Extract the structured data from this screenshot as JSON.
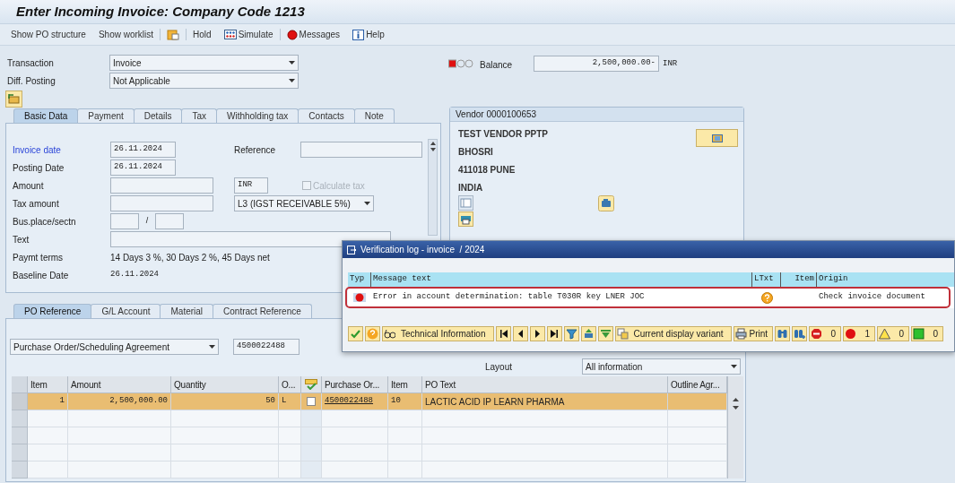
{
  "window": {
    "title": "Enter Incoming Invoice: Company Code 1213"
  },
  "toolbar": [
    [
      {
        "kind": "text",
        "label": "Show PO structure"
      },
      {
        "kind": "text",
        "label": "Show worklist"
      }
    ],
    [
      {
        "kind": "clipboard"
      }
    ],
    [
      {
        "kind": "text",
        "label": "Hold"
      },
      {
        "kind": "simulate",
        "label": "Simulate"
      }
    ],
    [
      {
        "kind": "messages",
        "label": "Messages"
      },
      {
        "kind": "help",
        "label": "Help"
      }
    ]
  ],
  "header": {
    "transaction": {
      "label": "Transaction",
      "value": "Invoice"
    },
    "diff_posting": {
      "label": "Diff. Posting",
      "value": "Not Applicable"
    },
    "balance": {
      "kind": "error",
      "label": "Balance",
      "value": "2,500,000.00-",
      "currency": "INR"
    }
  },
  "basic_tabs": [
    {
      "label": "Basic Data",
      "selected": true
    },
    {
      "label": "Payment",
      "selected": false
    },
    {
      "label": "Details",
      "selected": false
    },
    {
      "label": "Tax",
      "selected": false
    },
    {
      "label": "Withholding tax",
      "selected": false
    },
    {
      "label": "Contacts",
      "selected": false
    },
    {
      "label": "Note",
      "selected": false
    }
  ],
  "basic_data": {
    "invoice_date": {
      "label": "Invoice date",
      "value": "26.11.2024",
      "highlighted": true
    },
    "reference": {
      "label": "Reference"
    },
    "posting_date": {
      "label": "Posting Date",
      "value": "26.11.2024"
    },
    "amount": {
      "label": "Amount",
      "currency": "INR"
    },
    "calculate_tax": {
      "label": "Calculate tax",
      "checked": false,
      "disabled": true
    },
    "tax_amount": {
      "label": "Tax amount",
      "tax_code": "L3 (IGST RECEIVABLE 5%)"
    },
    "bus_place": {
      "label": "Bus.place/sectn",
      "separator": "/"
    },
    "text": {
      "label": "Text"
    },
    "payment_terms": {
      "label": "Paymt terms",
      "value": "14 Days 3 %, 30 Days 2 %, 45 Days net"
    },
    "baseline_date": {
      "label": "Baseline Date",
      "value": "26.11.2024"
    }
  },
  "vendor": {
    "title": "Vendor 0000100653",
    "lines": [
      "TEST VENDOR PPTP",
      "BHOSRI",
      "411018 PUNE",
      "INDIA"
    ]
  },
  "lower_tabs": [
    {
      "label": "PO Reference",
      "selected": true
    },
    {
      "label": "G/L Account",
      "selected": false
    },
    {
      "label": "Material",
      "selected": false
    },
    {
      "label": "Contract Reference",
      "selected": false
    }
  ],
  "po_reference": {
    "doc_type": "Purchase Order/Scheduling Agreement",
    "po_number": "4500022488",
    "layout_label": "Layout",
    "layout_value": "All information"
  },
  "items_table": {
    "columns": [
      {
        "kind": "text",
        "label": "Item"
      },
      {
        "kind": "text",
        "label": "Amount"
      },
      {
        "kind": "text",
        "label": "Quantity"
      },
      {
        "kind": "text",
        "label": "O..."
      },
      {
        "kind": "icon"
      },
      {
        "kind": "text",
        "label": "Purchase Or..."
      },
      {
        "kind": "text",
        "label": "Item"
      },
      {
        "kind": "text",
        "label": "PO Text"
      },
      {
        "kind": "text",
        "label": "Outline Agr..."
      }
    ],
    "rows": [
      {
        "selected": true,
        "item": "1",
        "amount": "2,500,000.00",
        "quantity": "50",
        "unit": "L",
        "checked": false,
        "po": "4500022488",
        "po_item": "10",
        "po_text": "LACTIC ACID IP LEARN PHARMA"
      }
    ]
  },
  "popup": {
    "title": "Verification log - invoice  / 2024",
    "columns": [
      "Typ",
      "Message text",
      "LTxt",
      "Item",
      "Origin"
    ],
    "messages": [
      {
        "kind": "error",
        "text": "Error in account determination: table T030R key LNER JOC",
        "long_text": true,
        "origin": "Check invoice document",
        "highlighted": true
      }
    ],
    "toolbar": [
      {
        "kind": "ok"
      },
      {
        "kind": "help"
      },
      {
        "kind": "tech",
        "label": "Technical Information"
      },
      {
        "kind": "first"
      },
      {
        "kind": "prev"
      },
      {
        "kind": "next"
      },
      {
        "kind": "last"
      },
      {
        "kind": "filter"
      },
      {
        "kind": "sum"
      },
      {
        "kind": "subtotal"
      },
      {
        "kind": "variant",
        "label": "Current display variant"
      },
      {
        "kind": "print",
        "label": "Print"
      },
      {
        "kind": "find"
      },
      {
        "kind": "find_next"
      },
      {
        "kind": "stop",
        "label": "0"
      },
      {
        "kind": "error",
        "label": "1"
      },
      {
        "kind": "warning",
        "label": "0"
      },
      {
        "kind": "success",
        "label": "0"
      }
    ]
  }
}
